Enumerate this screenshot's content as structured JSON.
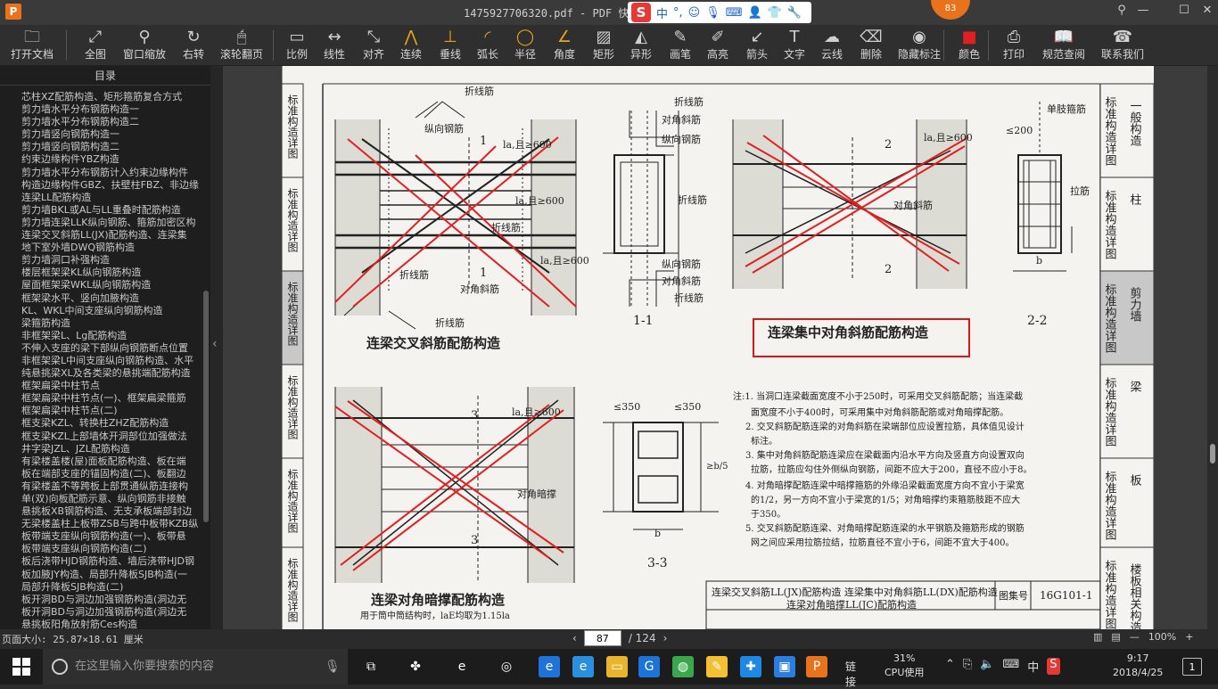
{
  "titlebar": {
    "app_logo": "P",
    "title": "1475927706320.pdf - PDF 快速看图",
    "ime_items": [
      "中",
      "°,",
      "☺",
      "🎙",
      "⌨",
      "👤",
      "👕",
      "🔧"
    ],
    "badge": "83",
    "controls": [
      "⚲",
      "—",
      "☐",
      "✕"
    ]
  },
  "toolbar": [
    {
      "label": "打开文档",
      "icon": "folder-icon",
      "glyph": "🗀"
    },
    {
      "label": "全图",
      "icon": "fit-icon",
      "glyph": "⤢"
    },
    {
      "label": "窗口缩放",
      "icon": "zoom-icon",
      "glyph": "⚲"
    },
    {
      "label": "右转",
      "icon": "rotate-icon",
      "glyph": "↻"
    },
    {
      "label": "滚轮翻页",
      "icon": "mouse-icon",
      "glyph": "🖱"
    },
    {
      "label": "比例",
      "icon": "scale-icon",
      "glyph": "▭"
    },
    {
      "label": "线性",
      "icon": "linear-icon",
      "glyph": "↔"
    },
    {
      "label": "对齐",
      "icon": "align-icon",
      "glyph": "⤡"
    },
    {
      "label": "连续",
      "icon": "continuous-icon",
      "glyph": "⋀"
    },
    {
      "label": "垂线",
      "icon": "perpendicular-icon",
      "glyph": "⊥"
    },
    {
      "label": "弧长",
      "icon": "arc-icon",
      "glyph": "◜"
    },
    {
      "label": "半径",
      "icon": "radius-icon",
      "glyph": "◯"
    },
    {
      "label": "角度",
      "icon": "angle-icon",
      "glyph": "∠"
    },
    {
      "label": "矩形",
      "icon": "rect-icon",
      "glyph": "▨"
    },
    {
      "label": "异形",
      "icon": "shape-icon",
      "glyph": "◭"
    },
    {
      "label": "画笔",
      "icon": "pen-icon",
      "glyph": "✎"
    },
    {
      "label": "高亮",
      "icon": "highlight-icon",
      "glyph": "✐"
    },
    {
      "label": "箭头",
      "icon": "arrow-icon",
      "glyph": "↙"
    },
    {
      "label": "文字",
      "icon": "text-icon",
      "glyph": "T"
    },
    {
      "label": "云线",
      "icon": "cloud-icon",
      "glyph": "☁"
    },
    {
      "label": "删除",
      "icon": "eraser-icon",
      "glyph": "⌫"
    },
    {
      "label": "隐藏标注",
      "icon": "hide-icon",
      "glyph": "◉"
    },
    {
      "label": "颜色",
      "icon": "color-icon",
      "glyph": "■"
    },
    {
      "label": "打印",
      "icon": "print-icon",
      "glyph": "⎙"
    },
    {
      "label": "规范查阅",
      "icon": "book-icon",
      "glyph": "📖"
    },
    {
      "label": "联系我们",
      "icon": "contact-icon",
      "glyph": "☎"
    }
  ],
  "sidebar": {
    "title": "目录",
    "items": [
      "芯柱XZ配筋构造、矩形箍筋复合方式",
      "剪力墙水平分布钢筋构造一",
      "剪力墙水平分布钢筋构造二",
      "剪力墙竖向钢筋构造一",
      "剪力墙竖向钢筋构造二",
      "约束边缘构件YBZ构造",
      "剪力墙水平分布钢筋计入约束边缘构件",
      "构造边缘构件GBZ、扶壁柱FBZ、非边缘",
      "连梁LL配筋构造",
      "剪力墙BKL或AL与LL重叠时配筋构造",
      "剪力墙连梁LLK纵向钢筋、箍筋加密区构",
      "连梁交叉斜筋LL(JX)配筋构造、连梁集",
      "地下室外墙DWQ钢筋构造",
      "剪力墙洞口补强构造",
      "楼层框架梁KL纵向钢筋构造",
      "屋面框架梁WKL纵向钢筋构造",
      "框架梁水平、竖向加腋构造",
      "KL、WKL中间支座纵向钢筋构造",
      "梁箍筋构造",
      "非框架梁L、Lg配筋构造",
      "不伸入支座的梁下部纵向钢筋断点位置",
      "非框架梁L中间支座纵向钢筋构造、水平",
      "纯悬挑梁XL及各类梁的悬挑端配筋构造",
      "框架扁梁中柱节点",
      "框架扁梁中柱节点(一)、框架扁梁箍筋",
      "框架扁梁中柱节点(二)",
      "框支梁KZL、转换柱ZHZ配筋构造",
      "框支梁KZL上部墙体开洞部位加强做法",
      "井字梁JZL、JZL配筋构造",
      "有梁楼盖楼(屋)面板配筋构造、板在端",
      "板在端部支座的锚固构造(二)、板翻边",
      "有梁楼盖不等跨板上部贯通纵筋连接构",
      "单(双)向板配筋示意、纵向钢筋非接触",
      "悬挑板XB钢筋构造、无支承板端部封边",
      "无梁楼盖柱上板带ZSB与跨中板带KZB纵",
      "板带端支座纵向钢筋构造(一)、板带悬",
      "板带端支座纵向钢筋构造(二)",
      "板后浇带HJD钢筋构造、墙后浇带HJD钢",
      "板加腋JY构造、局部升降板SJB构造(一",
      "局部升降板SJB构造(二)",
      "板开洞BD与洞边加强钢筋构造(洞边无",
      "板开洞BD与洞边加强钢筋构造(洞边无",
      "悬挑板阳角放射筋Ces构造"
    ]
  },
  "drawing": {
    "side_tabs": [
      {
        "a": "标准构造详图",
        "b": "一般构造"
      },
      {
        "a": "标准构造详图",
        "b": "柱"
      },
      {
        "a": "标准构造详图",
        "b": "剪力墙"
      },
      {
        "a": "标准构造详图",
        "b": "梁"
      },
      {
        "a": "标准构造详图",
        "b": "板"
      },
      {
        "a": "标准构造详图",
        "b": "楼板相关构造"
      }
    ],
    "left_tabs": [
      "标准构造详图",
      "标准构造详图",
      "标准构造详图",
      "标准构造详图",
      "标准构造详图",
      "标准构造详图"
    ],
    "labels": {
      "zhexianjin": "折线筋",
      "zongxiang": "纵向钢筋",
      "duijiao": "对角斜筋",
      "anchor600": "la,且≥600",
      "section1": "1",
      "section2": "2",
      "section3": "3",
      "sec11": "1-1",
      "sec22": "2-2",
      "sec33": "3-3",
      "title1": "连梁交叉斜筋配筋构造",
      "title2": "连梁集中对角斜筋配筋构造",
      "title3": "连梁对角暗撑配筋构造",
      "note3": "用于筒中筒结构时，laE均取为1.15la",
      "danzhi": "单肢箍筋",
      "lajin": "拉筋",
      "dim200": "≤200",
      "dim350": "≤350",
      "b": "b",
      "duijiaoanche": "对角暗撑",
      "b2": "≥b/5"
    },
    "notes": [
      "注:1. 当洞口连梁截面宽度不小于250时，可采用交叉斜筋配筋；当连梁截",
      "面宽度不小于400时，可采用集中对角斜筋配筋或对角暗撑配筋。",
      "2. 交叉斜筋配筋连梁的对角斜筋在梁端部位应设置拉筋，具体值见设计",
      "标注。",
      "3. 集中对角斜筋配筋连梁应在梁截面内沿水平方向及竖直方向设置双向",
      "拉筋，拉筋应勾住外侧纵向钢筋，间距不应大于200，直径不应小于8。",
      "4. 对角暗撑配筋连梁中暗撑箍筋的外缘沿梁截面宽度方向不宜小于梁宽",
      "的1/2，另一方向不宜小于梁宽的1/5；对角暗撑约束箍筋肢距不应大",
      "于350。",
      "5. 交叉斜筋配筋连梁、对角暗撑配筋连梁的水平钢筋及箍筋形成的钢筋",
      "网之间应采用拉筋拉结，拉筋直径不宜小于6，间距不宜大于400。"
    ],
    "titleblock": {
      "line1": "连梁交叉斜筋LL(JX)配筋构造  连梁集中对角斜筋LL(DX)配筋构造",
      "line2": "连梁对角暗撑LL(JC)配筋构造",
      "label": "图集号",
      "code": "16G101-1"
    }
  },
  "statusbar": {
    "page_size": "页面大小: 25.87×18.61 厘米",
    "current_page": "87",
    "total_pages": "/ 124",
    "zoom": "100%"
  },
  "taskbar": {
    "search_placeholder": "在这里输入你要搜索的内容",
    "link_label": "链接",
    "cpu_value": "31%",
    "cpu_label": "CPU使用",
    "ime": "中",
    "time": "9:17",
    "date": "2018/4/25",
    "notify": "1"
  },
  "colors": {
    "red_markup": "#e02020",
    "highlight_box": "#d81818",
    "orange_accent": "#e8731c"
  }
}
